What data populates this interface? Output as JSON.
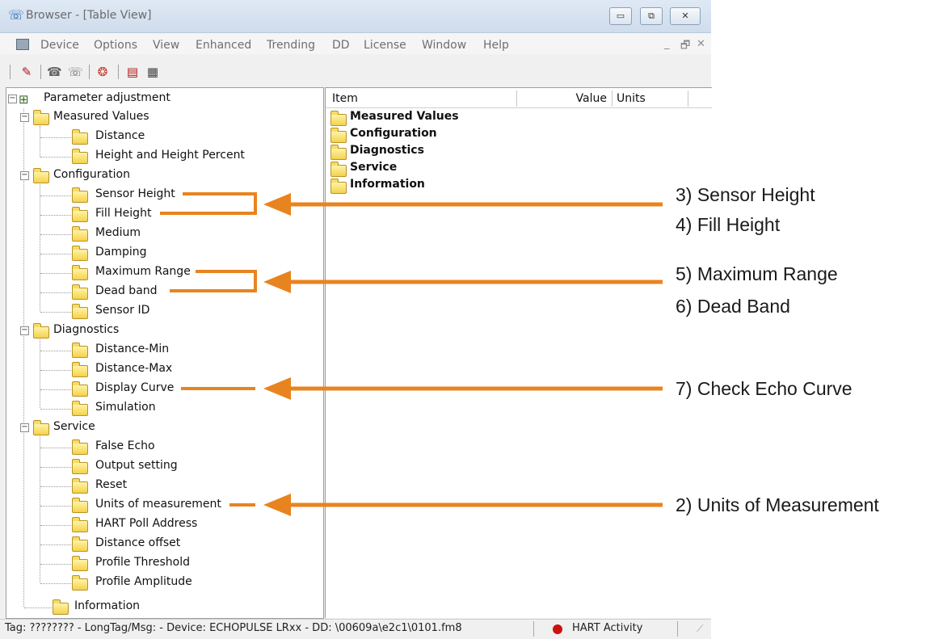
{
  "window": {
    "title": "Browser - [Table View]"
  },
  "menubar": {
    "items": [
      "Device",
      "Options",
      "View",
      "Enhanced",
      "Trending",
      "DD",
      "License",
      "Window",
      "Help"
    ]
  },
  "toolbar": {
    "icons": [
      "new-device-icon",
      "connect-icon",
      "disconnect-icon",
      "device-info-icon",
      "pdf-report-icon",
      "print-report-icon"
    ]
  },
  "tree": {
    "root": "Parameter adjustment",
    "groups": [
      {
        "label": "Measured Values",
        "children": [
          "Distance",
          "Height and Height Percent"
        ]
      },
      {
        "label": "Configuration",
        "children": [
          "Sensor Height",
          "Fill Height",
          "Medium",
          "Damping",
          "Maximum Range",
          "Dead band",
          "Sensor ID"
        ]
      },
      {
        "label": "Diagnostics",
        "children": [
          "Distance-Min",
          "Distance-Max",
          "Display Curve",
          "Simulation"
        ]
      },
      {
        "label": "Service",
        "children": [
          "False Echo",
          "Output setting",
          "Reset",
          "Units of measurement",
          "HART Poll Address",
          "Distance offset",
          "Profile Threshold",
          "Profile Amplitude"
        ]
      },
      {
        "label": "Information",
        "children": []
      }
    ]
  },
  "list": {
    "columns": [
      "Item",
      "Value",
      "Units"
    ],
    "rows": [
      "Measured Values",
      "Configuration",
      "Diagnostics",
      "Service",
      "Information"
    ]
  },
  "status": {
    "text": "Tag: ???????? - LongTag/Msg:  - Device: ECHOPULSE LRxx - DD: \\00609a\\e2c1\\0101.fm8",
    "activity": "HART Activity",
    "activity_color": "#cc1111"
  },
  "annotations": {
    "color": "#e8841f",
    "labels": {
      "sensor_height": "3) Sensor Height",
      "fill_height": "4) Fill Height",
      "maximum_range": "5) Maximum Range",
      "dead_band": "6) Dead Band",
      "echo_curve": "7) Check Echo Curve",
      "units": "2) Units of Measurement"
    }
  }
}
